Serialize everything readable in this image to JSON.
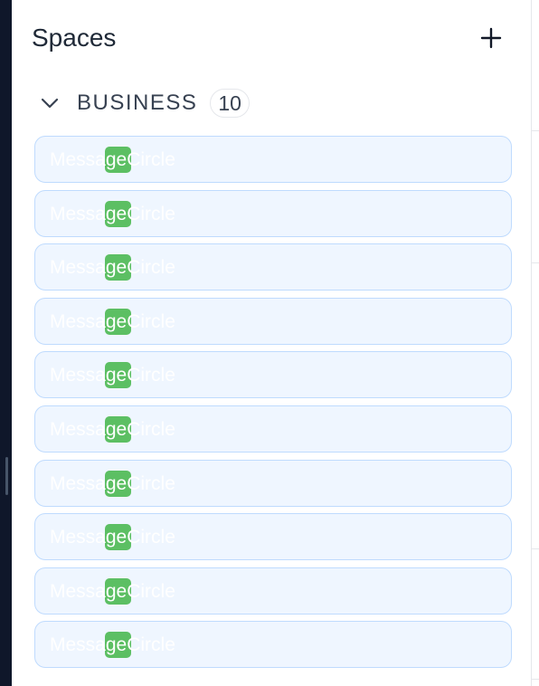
{
  "panel": {
    "title": "Spaces",
    "add_icon": "plus-icon"
  },
  "group": {
    "name": "BUSINESS",
    "count": "10",
    "toggle_icon": "chevron-down-icon"
  },
  "spaces": [
    {
      "label": "MessageCircle",
      "icon": "message-circle-icon"
    },
    {
      "label": "MessageCircle",
      "icon": "message-circle-icon"
    },
    {
      "label": "MessageCircle",
      "icon": "message-circle-icon"
    },
    {
      "label": "MessageCircle",
      "icon": "message-circle-icon"
    },
    {
      "label": "MessageCircle",
      "icon": "message-circle-icon"
    },
    {
      "label": "MessageCircle",
      "icon": "message-circle-icon"
    },
    {
      "label": "MessageCircle",
      "icon": "message-circle-icon"
    },
    {
      "label": "MessageCircle",
      "icon": "message-circle-icon"
    },
    {
      "label": "MessageCircle",
      "icon": "message-circle-icon"
    },
    {
      "label": "MessageCircle",
      "icon": "message-circle-icon"
    }
  ],
  "colors": {
    "icon_fill": "#5cbf63",
    "item_background": "#eff6ff",
    "item_border": "#bfdbfe"
  }
}
